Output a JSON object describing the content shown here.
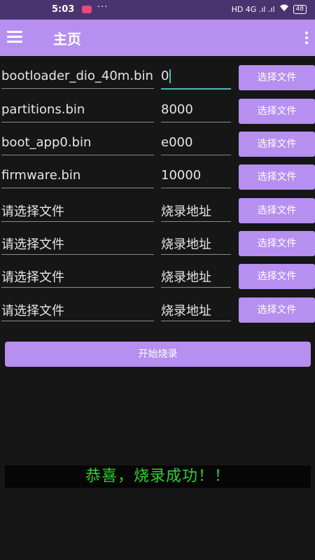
{
  "status_bar": {
    "time": "5:03",
    "dots": "···",
    "signal_text": "HD 4G .ıl .ıl",
    "battery": "48"
  },
  "app_bar": {
    "title": "主页"
  },
  "rows": [
    {
      "file": "bootloader_dio_40m.bin",
      "address": "0",
      "button": "选择文件"
    },
    {
      "file": "partitions.bin",
      "address": "8000",
      "button": "选择文件"
    },
    {
      "file": "boot_app0.bin",
      "address": "e000",
      "button": "选择文件"
    },
    {
      "file": "firmware.bin",
      "address": "10000",
      "button": "选择文件"
    },
    {
      "file": "请选择文件",
      "address": "烧录地址",
      "button": "选择文件"
    },
    {
      "file": "请选择文件",
      "address": "烧录地址",
      "button": "选择文件"
    },
    {
      "file": "请选择文件",
      "address": "烧录地址",
      "button": "选择文件"
    },
    {
      "file": "请选择文件",
      "address": "烧录地址",
      "button": "选择文件"
    }
  ],
  "burn_button": "开始烧录",
  "result_message": "恭喜，烧录成功！！",
  "colors": {
    "accent": "#b68ff0",
    "background": "#161616",
    "success_text": "#2ed12e",
    "focus_line": "#4fb8b0"
  }
}
